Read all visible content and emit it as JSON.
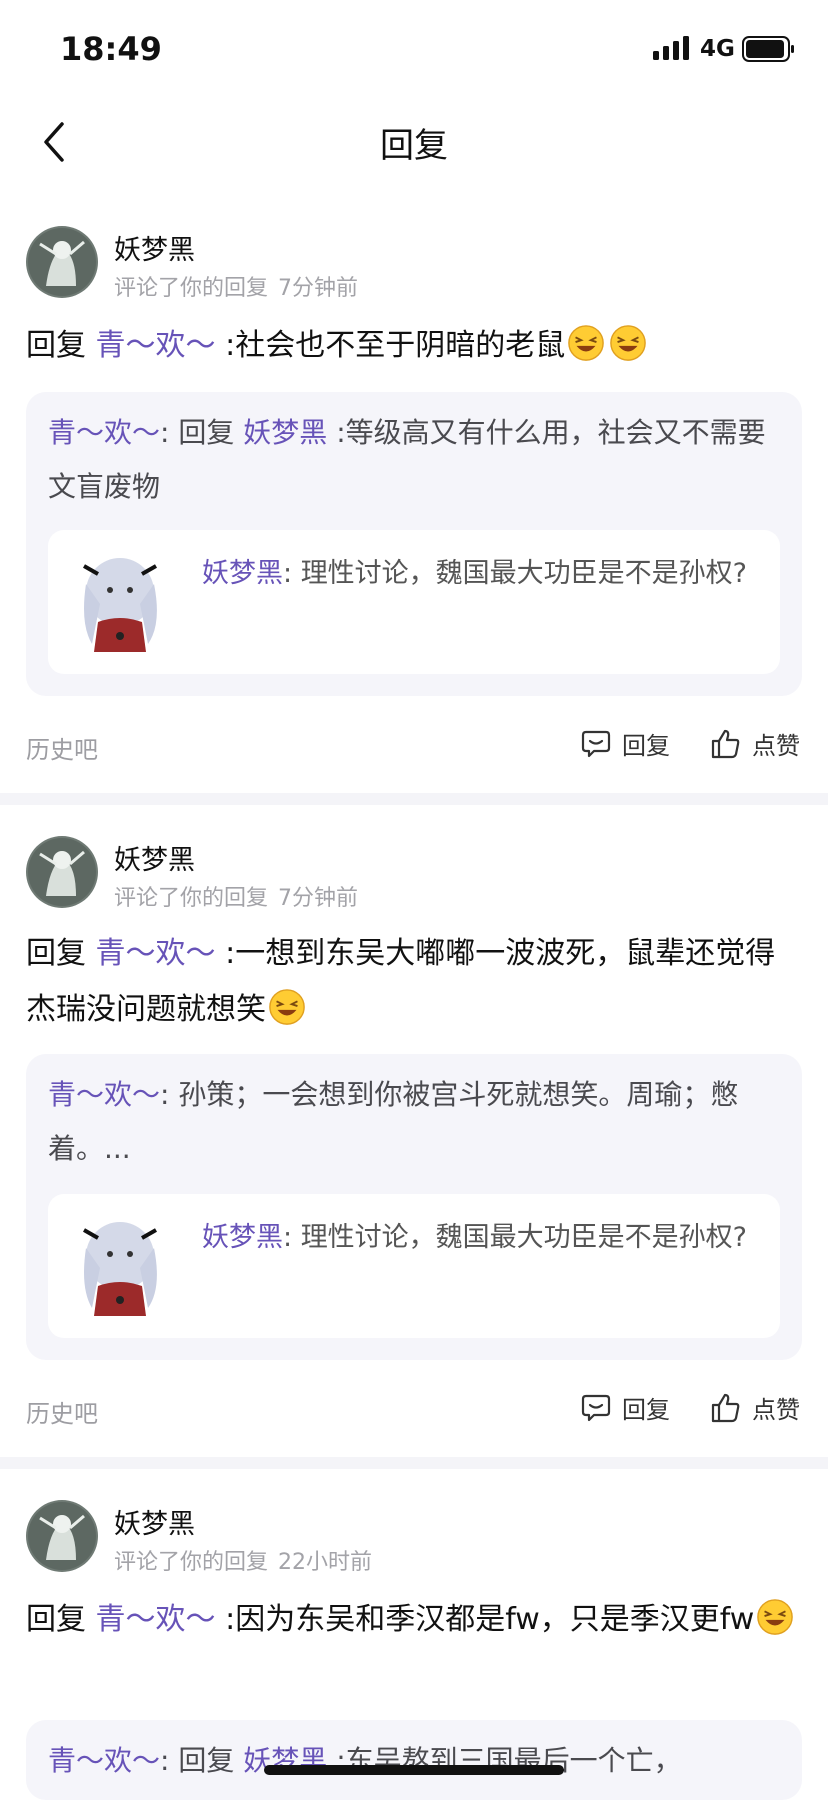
{
  "status_bar": {
    "time": "18:49",
    "network": "4G"
  },
  "nav": {
    "title": "回复"
  },
  "comments": [
    {
      "username": "妖梦黑",
      "action": "评论了你的回复",
      "ago": "7分钟前",
      "reply_prefix": "回复",
      "reply_to": "青～欢～",
      "text": ":社会也不至于阴暗的老鼠",
      "emoji_count": 2,
      "quote": {
        "author": "青～欢～",
        "separator": ": ",
        "reply_prefix": "回复",
        "reply_to": "妖梦黑",
        "text": ":等级高又有什么用，社会又不需要文盲废物"
      },
      "inner": {
        "author": "妖梦黑",
        "separator": ": ",
        "text": "理性讨论，魏国最大功臣是不是孙权?"
      },
      "source": "历史吧",
      "reply_label": "回复",
      "like_label": "点赞"
    },
    {
      "username": "妖梦黑",
      "action": "评论了你的回复",
      "ago": "7分钟前",
      "reply_prefix": "回复",
      "reply_to": "青～欢～",
      "text": ":一想到东吴大嘟嘟一波波死，鼠辈还觉得杰瑞没问题就想笑",
      "emoji_count": 1,
      "quote": {
        "author": "青～欢～",
        "separator": ": ",
        "reply_prefix": "",
        "reply_to": "",
        "text": "孙策；一会想到你被宫斗死就想笑。周瑜；憋着。..."
      },
      "inner": {
        "author": "妖梦黑",
        "separator": ": ",
        "text": "理性讨论，魏国最大功臣是不是孙权?"
      },
      "source": "历史吧",
      "reply_label": "回复",
      "like_label": "点赞"
    },
    {
      "username": "妖梦黑",
      "action": "评论了你的回复",
      "ago": "22小时前",
      "reply_prefix": "回复",
      "reply_to": "青～欢～",
      "text": ":因为东吴和季汉都是fw，只是季汉更fw",
      "emoji_count": 1,
      "quote": {
        "author": "青～欢～",
        "separator": ": ",
        "reply_prefix": "回复",
        "reply_to": "妖梦黑",
        "text": ":东吴熬到三国最后一个亡，"
      }
    }
  ],
  "colors": {
    "accent": "#6753b8",
    "quote_bg": "#f5f5fa",
    "divider": "#f4f4f8"
  }
}
